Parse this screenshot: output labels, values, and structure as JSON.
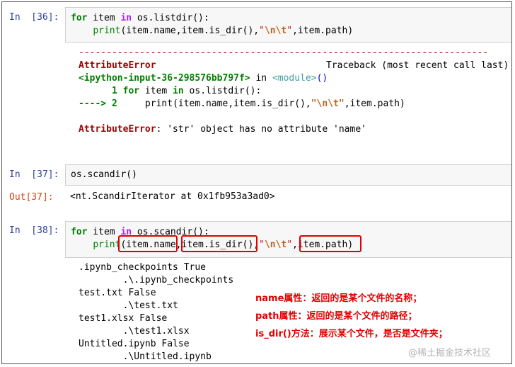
{
  "cells": {
    "c36": {
      "prompt": "In  [36]:",
      "code": {
        "l1": {
          "kw1": "for",
          "var": " item ",
          "kw2": "in",
          "rest": " os.listdir():"
        },
        "l2": {
          "indent": "    ",
          "fn": "print",
          "args": "(item.name,item.is_dir(),",
          "q1": "\"",
          "esc": "\\n\\t",
          "q2": "\"",
          "tail": ",item.path)"
        }
      },
      "error": {
        "dashes": "--------------------------------------------------------------------------",
        "name": "AttributeError",
        "traceback": "Traceback (most recent call last)",
        "location": "<ipython-input-36-298576bb797f>",
        "in_word": " in ",
        "module": "<module>",
        "module_paren": "()",
        "tb1_num": "      1 ",
        "tb1_kw1": "for",
        "tb1_var": " item ",
        "tb1_kw2": "in",
        "tb1_rest": " os.listdir():",
        "arrow": "----> 2",
        "tb2_code": "     print(item.name,item.is_dir(),",
        "tb2_str": "\"\\n\\t\"",
        "tb2_tail": ",item.path)",
        "msg_name": "AttributeError",
        "msg_text": ": 'str' object has no attribute 'name'"
      }
    },
    "c37": {
      "prompt": "In  [37]:",
      "code": "os.scandir()",
      "out_prompt": "Out[37]:",
      "output": "<nt.ScandirIterator at 0x1fb953a3ad0>"
    },
    "c38": {
      "prompt": "In  [38]:",
      "code": {
        "l1": {
          "kw1": "for",
          "var": " item ",
          "kw2": "in",
          "rest": " os.scandir():"
        },
        "l2": {
          "indent": "    ",
          "fn": "print",
          "args": "(item.name,item.is_dir(),",
          "q1": "\"",
          "esc": "\\n\\t",
          "q2": "\"",
          "tail": ",item.path)"
        }
      },
      "output": [
        ".ipynb_checkpoints True",
        "        .\\.ipynb_checkpoints",
        "test.txt False",
        "        .\\test.txt",
        "test1.xlsx False",
        "        .\\test1.xlsx",
        "Untitled.ipynb False",
        "        .\\Untitled.ipynb"
      ]
    }
  },
  "notes": [
    "name属性：返回的是某个文件的名称；",
    "path属性：返回的是某个文件的路径；",
    "is_dir()方法：展示某个文件，是否是文件夹；"
  ],
  "watermark": "@稀土掘金技术社区",
  "colors": {
    "highlight": "#e00000",
    "prompt_in": "#303f9f",
    "prompt_out": "#d84315"
  }
}
